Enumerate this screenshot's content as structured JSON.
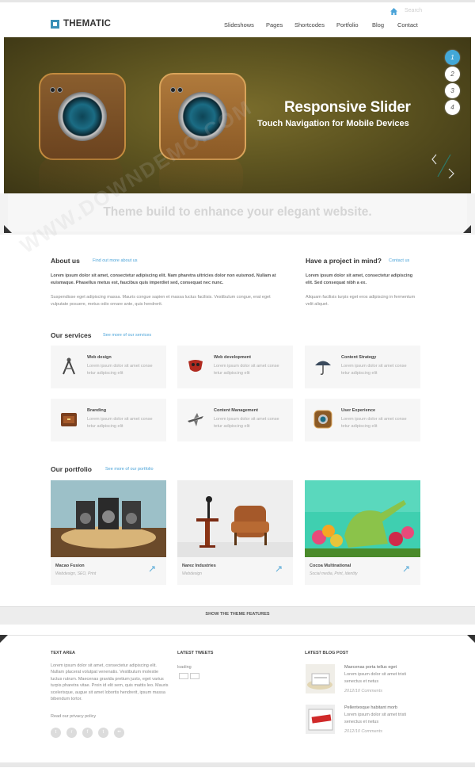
{
  "header": {
    "search_label": "Search",
    "logo_text": "THEMATIC",
    "nav": [
      "Slideshows",
      "Pages",
      "Shortcodes",
      "Portfolio",
      "Blog",
      "Contact"
    ]
  },
  "slider": {
    "title": "Responsive Slider",
    "subtitle": "Touch Navigation for Mobile Devices",
    "pages": [
      "1",
      "2",
      "3",
      "4"
    ],
    "active_page": "1"
  },
  "tagline": "Theme build to enhance your elegant website.",
  "about": {
    "title": "About us",
    "link": "Find out more about us",
    "lead": "Lorem ipsum dolor sit amet, consectetur adipiscing elit. Nam pharetra ultricies dolor non euismod. Nullam at euismaque. Phasellus metus est, faucibus quis imperdiet sed, consequat nec nunc.",
    "body": "Suspendisse eget adipiscing massa. Mauris congue sapien et massa luctus facilisis. Vestibulum congue, erat eget vulputate posuere, metus odio ornare ante, quis hendrerit."
  },
  "project": {
    "title": "Have a project in mind?",
    "link": "Contact us",
    "lead": "Lorem ipsum dolor sit amet, consectetur adipiscing elit. Sed consequat nibh a ex.",
    "body": "Aliquam facilisis turpis eget eros adipiscing in fermentum velit aliquet."
  },
  "services": {
    "title": "Our services",
    "link": "See more of our services",
    "items": [
      {
        "title": "Web design",
        "text": "Lorem ipsum dolor sit amet conse tetur adipiscing elit",
        "icon": "compass-icon"
      },
      {
        "title": "Web development",
        "text": "Lorem ipsum dolor sit amet conse tetur adipiscing elit",
        "icon": "mask-icon"
      },
      {
        "title": "Content Strategy",
        "text": "Lorem ipsum dolor sit amet conse tetur adipiscing elit",
        "icon": "umbrella-icon"
      },
      {
        "title": "Branding",
        "text": "Lorem ipsum dolor sit amet conse tetur adipiscing elit",
        "icon": "drawer-icon"
      },
      {
        "title": "Content Management",
        "text": "Lorem ipsum dolor sit amet conse tetur adipiscing elit",
        "icon": "plane-icon"
      },
      {
        "title": "User Experience",
        "text": "Lorem ipsum dolor sit amet conse tetur adipiscing elit",
        "icon": "camera-icon"
      }
    ]
  },
  "portfolio": {
    "title": "Our portfolio",
    "link": "See more of our portfolio",
    "items": [
      {
        "title": "Macao Fusion",
        "category": "Webdesign, SEO, Print"
      },
      {
        "title": "Narez Industries",
        "category": "Webdesign"
      },
      {
        "title": "Cocoa Multinational",
        "category": "Social media, Print, Identity"
      }
    ]
  },
  "features_label": "SHOW THE THEME FEATURES",
  "footer": {
    "text_area": {
      "title": "TEXT AREA",
      "body": "Lorem ipsum dolor sit amet, consectetur adipiscing elit. Nullam placerat volutpat venenatis. Vestibulum molestie luctus rutrum. Maecenas gravida pretium justo, eget varius turpis pharetra vitae. Proin id elit sem, quis mattis leo. Mauris scelerisque, augue sit amet lobortis hendrerit, ipsum massa bibendum tortor.",
      "link": "Read our privacy policy"
    },
    "tweets": {
      "title": "LATEST TWEETS",
      "status": "loading"
    },
    "blog": {
      "title": "LATEST BLOG POST",
      "posts": [
        {
          "title": "Maecenas porta tellus eget",
          "text": "Lorem ipsum dolor sit amet tristi senectus et netus",
          "date": "2012/10 Comments"
        },
        {
          "title": "Pellentesque habitant morb",
          "text": "Lorem ipsum dolor sit amet tristi senectus et netus",
          "date": "2012/10 Comments"
        }
      ]
    }
  },
  "watermark": "WWW.DOWNDEMO.COM"
}
